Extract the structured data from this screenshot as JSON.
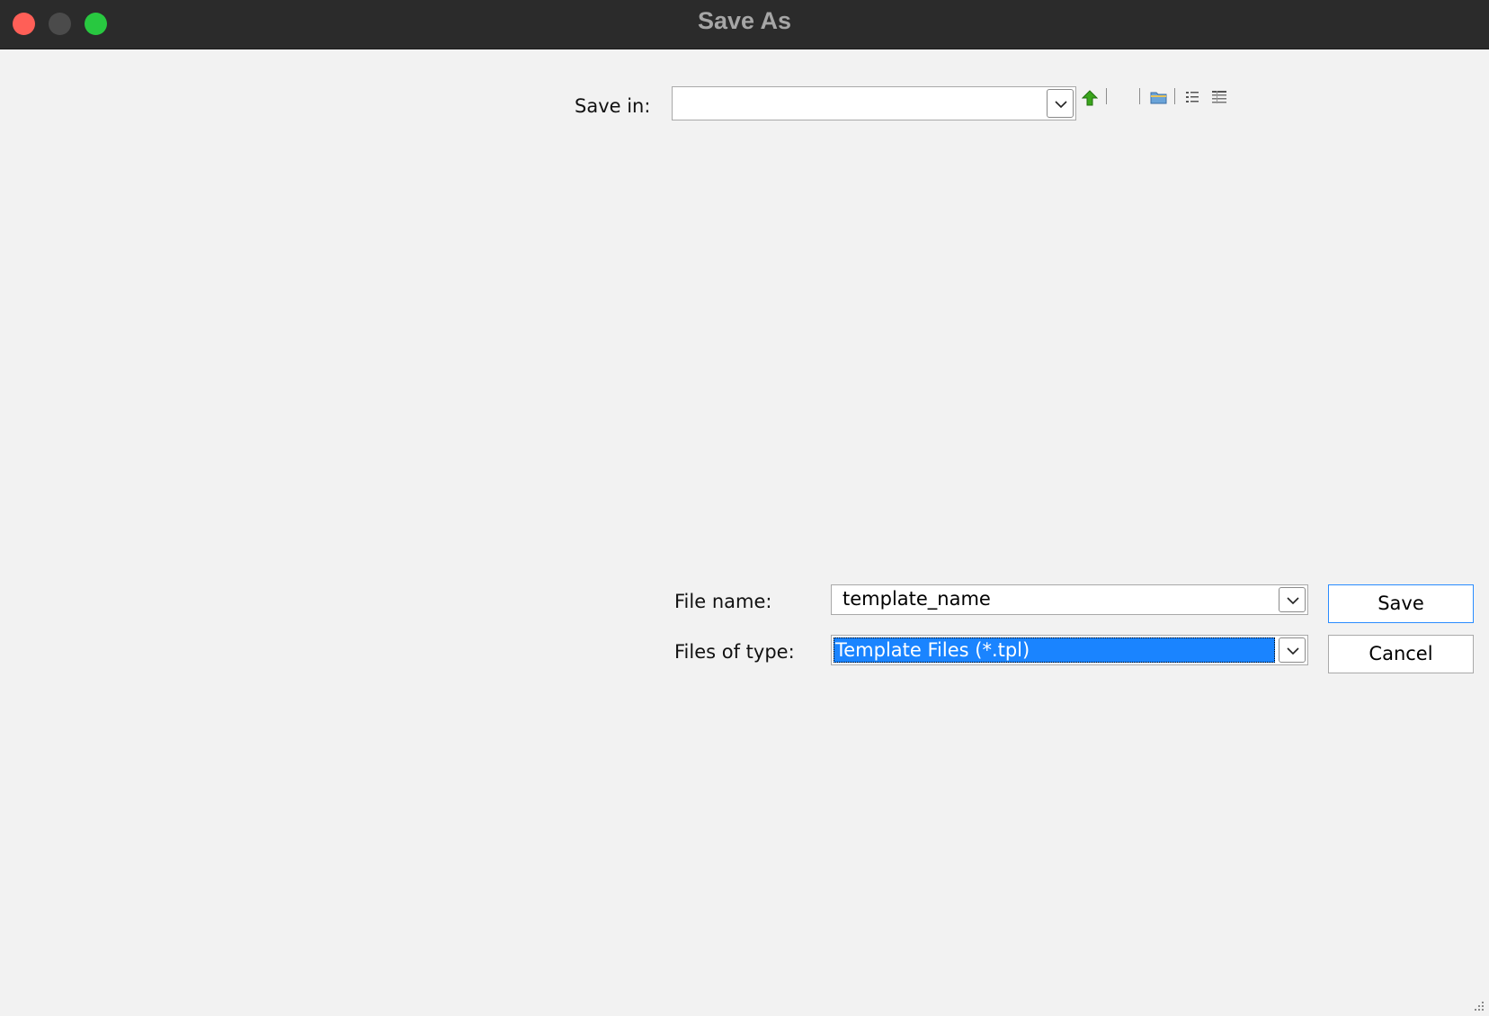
{
  "window": {
    "title": "Save As"
  },
  "toolbar": {
    "save_in_label": "Save in:",
    "save_in_value": "",
    "up_icon": "up-one-level-icon",
    "new_folder_icon": "create-new-folder-icon",
    "list_icon": "list-view-icon",
    "details_icon": "details-view-icon"
  },
  "form": {
    "file_name_label": "File name:",
    "file_name_value": "template_name",
    "files_of_type_label": "Files of type:",
    "files_of_type_value": "Template Files (*.tpl)"
  },
  "buttons": {
    "save": "Save",
    "cancel": "Cancel"
  },
  "colors": {
    "selection": "#1a84ff",
    "default_button_border": "#2a8cff",
    "up_arrow": "#3aa51c"
  }
}
